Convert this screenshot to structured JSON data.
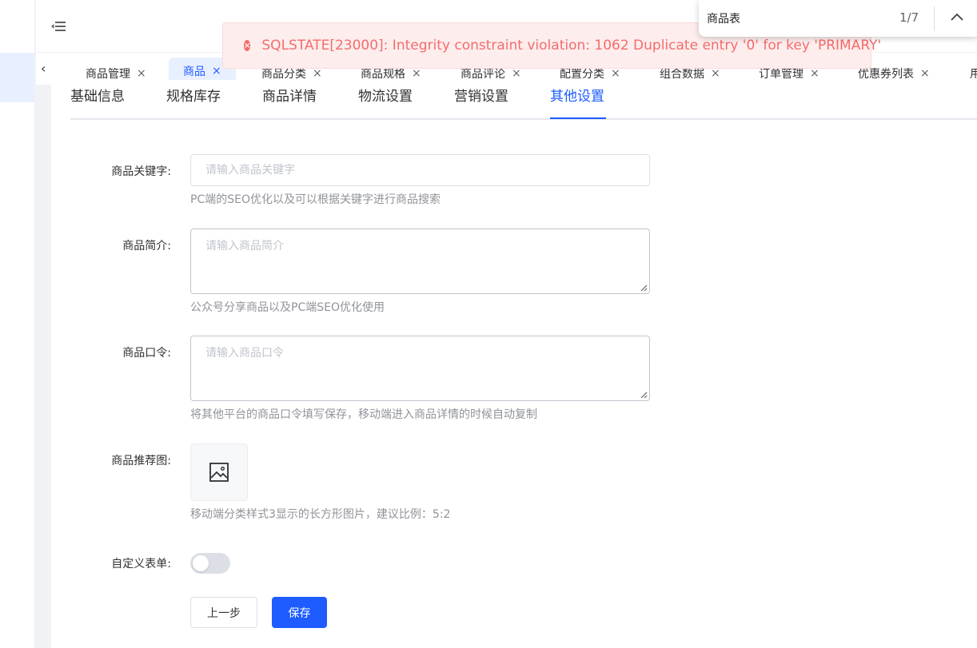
{
  "tabs": [
    {
      "label": "商品管理",
      "close": "×"
    },
    {
      "label": "商品",
      "close": "×"
    },
    {
      "label": "商品分类",
      "close": "×"
    },
    {
      "label": "商品规格",
      "close": "×"
    },
    {
      "label": "商品评论",
      "close": "×"
    },
    {
      "label": "配置分类",
      "close": "×"
    },
    {
      "label": "组合数据",
      "close": "×"
    },
    {
      "label": "订单管理",
      "close": "×"
    },
    {
      "label": "优惠券列表",
      "close": "×"
    },
    {
      "label": "用"
    }
  ],
  "subtabs": [
    "基础信息",
    "规格库存",
    "商品详情",
    "物流设置",
    "营销设置",
    "其他设置"
  ],
  "form": {
    "keyword": {
      "label": "商品关键字:",
      "placeholder": "请输入商品关键字",
      "hint": "PC端的SEO优化以及可以根据关键字进行商品搜索"
    },
    "intro": {
      "label": "商品简介:",
      "placeholder": "请输入商品简介",
      "hint": "公众号分享商品以及PC端SEO优化使用"
    },
    "password": {
      "label": "商品口令:",
      "placeholder": "请输入商品口令",
      "hint": "将其他平台的商品口令填写保存，移动端进入商品详情的时候自动复制"
    },
    "recommend_image": {
      "label": "商品推荐图:",
      "hint": "移动端分类样式3显示的长方形图片，建议比例：5:2"
    },
    "custom_form": {
      "label": "自定义表单:",
      "enabled": false
    }
  },
  "buttons": {
    "prev": "上一步",
    "save": "保存"
  },
  "alert": {
    "icon": "×",
    "text": "SQLSTATE[23000]: Integrity constraint violation: 1062 Duplicate entry '0' for key 'PRIMARY'"
  },
  "find_bar": {
    "query": "商品表",
    "count": "1/7"
  },
  "colors": {
    "accent": "#1e5cff",
    "error": "#f56c6c"
  }
}
